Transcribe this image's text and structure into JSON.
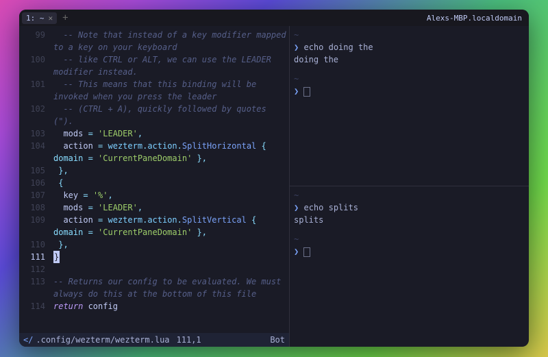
{
  "tabbar": {
    "tab_label": "1: ~",
    "close_glyph": "✕",
    "new_tab_glyph": "+",
    "right_title": "Alexs-MBP.localdomain"
  },
  "editor": {
    "lines": {
      "l99": "-- Note that instead of a key modifier mapped to a key on your keyboard",
      "l100": "-- like CTRL or ALT, we can use the LEADER modifier instead.",
      "l101": "-- This means that this binding will be invoked when you press the leader",
      "l102": "-- (CTRL + A), quickly followed by quotes (\").",
      "l103_mods": "mods",
      "l103_eq": " = ",
      "l103_val": "'LEADER'",
      "l103_comma": ",",
      "l104_action": "action",
      "l104_eq": " = ",
      "l104_wez": "wezterm",
      "l104_dot1": ".",
      "l104_actmod": "action",
      "l104_dot2": ".",
      "l104_fn": "SplitHorizontal",
      "l104_tail": " { domain = ",
      "l104_str": "'CurrentPaneDomain'",
      "l104_close": " },",
      "l105": "},",
      "l106": "{",
      "l107_key": "key",
      "l107_eq": " = ",
      "l107_val": "'%'",
      "l107_comma": ",",
      "l108_mods": "mods",
      "l108_eq": " = ",
      "l108_val": "'LEADER'",
      "l108_comma": ",",
      "l109_action": "action",
      "l109_eq": " = ",
      "l109_wez": "wezterm",
      "l109_dot1": ".",
      "l109_actmod": "action",
      "l109_dot2": ".",
      "l109_fn": "SplitVertical",
      "l109_tail": " { domain = ",
      "l109_str": "'CurrentPaneDomain'",
      "l109_close": " },",
      "l110": "},",
      "l111": "}",
      "l113": "-- Returns our config to be evaluated. We must always do this at the bottom of this file",
      "l114_ret": "return",
      "l114_cfg": " config"
    },
    "gutter": {
      "n99": "99",
      "n100": "100",
      "n101": "101",
      "n102": "102",
      "n103": "103",
      "n104": "104",
      "n105": "105",
      "n106": "106",
      "n107": "107",
      "n108": "108",
      "n109": "109",
      "n110": "110",
      "n111": "111",
      "n112": "112",
      "n113": "113",
      "n114": "114"
    }
  },
  "statusline": {
    "mode_glyph": "</",
    "path": ".config/wezterm/wezterm.lua",
    "pos": "111,1",
    "scroll": "Bot"
  },
  "shell": {
    "prompt_glyph": "❯",
    "p1_cmd": "echo doing the",
    "p1_out": "doing the",
    "p2_cmd": "echo splits",
    "p2_out": "splits",
    "tilde": "~"
  }
}
